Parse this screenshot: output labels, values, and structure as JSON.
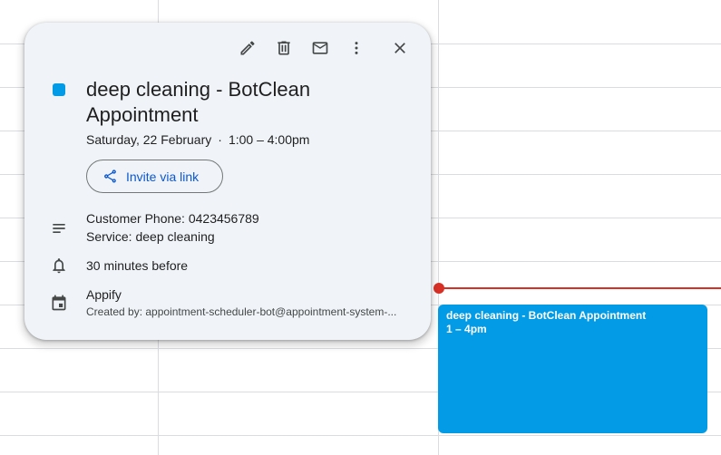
{
  "event": {
    "title": "deep cleaning - BotClean Appointment",
    "time": "1 – 4pm",
    "color": "#039be5"
  },
  "popup": {
    "toolbar": {
      "edit_icon": "pencil-icon",
      "delete_icon": "trash-icon",
      "email_icon": "mail-icon",
      "more_icon": "more-vertical-icon",
      "close_icon": "close-icon"
    },
    "title_line1": "deep cleaning - BotClean",
    "title_line2": "Appointment",
    "date": "Saturday, 22 February",
    "separator": "·",
    "time_range": "1:00 – 4:00pm",
    "invite_label": "Invite via link",
    "description_line1": "Customer Phone: 0423456789",
    "description_line2": "Service: deep cleaning",
    "reminder": "30 minutes before",
    "calendar_name": "Appify",
    "created_by": "Created by: appointment-scheduler-bot@appointment-system-..."
  },
  "colors": {
    "accent": "#039be5",
    "now_indicator": "#d93025",
    "link_blue": "#0b57d0",
    "popup_bg": "#f0f4f9"
  }
}
